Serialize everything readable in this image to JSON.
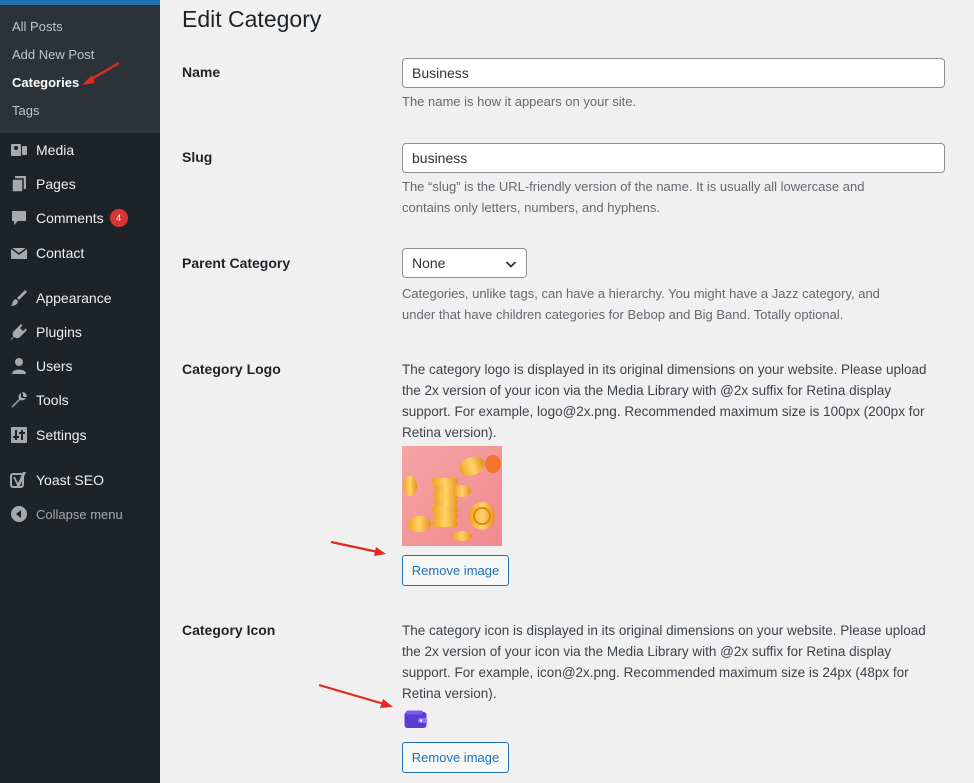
{
  "sidebar": {
    "submenu": [
      {
        "label": "All Posts"
      },
      {
        "label": "Add New Post"
      },
      {
        "label": "Categories"
      },
      {
        "label": "Tags"
      }
    ],
    "menu": [
      {
        "label": "Media",
        "icon": "media-icon"
      },
      {
        "label": "Pages",
        "icon": "pages-icon"
      },
      {
        "label": "Comments",
        "icon": "comments-icon",
        "badge": "4"
      },
      {
        "label": "Contact",
        "icon": "mail-icon"
      },
      {
        "label": "Appearance",
        "icon": "paintbrush-icon"
      },
      {
        "label": "Plugins",
        "icon": "plugins-icon"
      },
      {
        "label": "Users",
        "icon": "users-icon"
      },
      {
        "label": "Tools",
        "icon": "wrench-icon"
      },
      {
        "label": "Settings",
        "icon": "settings-icon"
      },
      {
        "label": "Yoast SEO",
        "icon": "yoast-icon"
      },
      {
        "label": "Collapse menu",
        "icon": "collapse-icon"
      }
    ]
  },
  "main": {
    "title": "Edit Category",
    "name": {
      "label": "Name",
      "value": "Business",
      "description": "The name is how it appears on your site."
    },
    "slug": {
      "label": "Slug",
      "value": "business",
      "description_line1": "The “slug” is the URL-friendly version of the name. It is usually all lowercase and",
      "description_line2": "contains only letters, numbers, and hyphens."
    },
    "parent": {
      "label": "Parent Category",
      "selected": "None",
      "description_line1": "Categories, unlike tags, can have a hierarchy. You might have a Jazz category, and",
      "description_line2": "under that have children categories for Bebop and Big Band. Totally optional."
    },
    "logo": {
      "label": "Category Logo",
      "description_line1": "The category logo is displayed in its original dimensions on your website. Please upload",
      "description_line2": "the 2x version of your icon via the Media Library with @2x suffix for Retina display",
      "description_line3": "support. For example, logo@2x.png. Recommended maximum size is 100px (200px for",
      "description_line4": "Retina version).",
      "remove_label": "Remove image"
    },
    "icon": {
      "label": "Category Icon",
      "description_line1": "The category icon is displayed in its original dimensions on your website. Please upload",
      "description_line2": "the 2x version of your icon via the Media Library with @2x suffix for Retina display",
      "description_line3": "support. For example, icon@2x.png. Recommended maximum size is 24px (48px for",
      "description_line4": "Retina version).",
      "remove_label": "Remove image"
    }
  },
  "colors": {
    "sidebar_bg": "#1d2327",
    "submenu_bg": "#2c3338",
    "accent": "#2271b1",
    "badge": "#d63638",
    "arrow": "#e02b20"
  }
}
